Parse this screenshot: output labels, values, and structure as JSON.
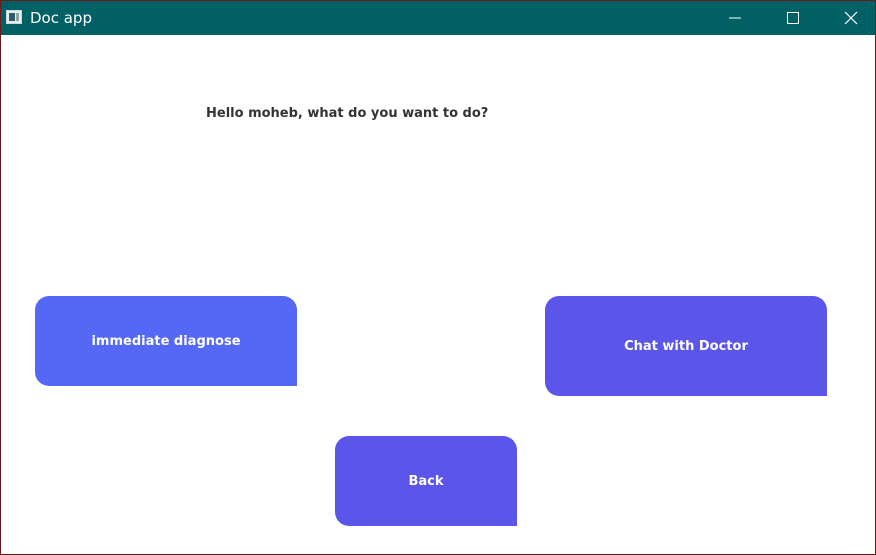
{
  "window": {
    "title": "Doc app",
    "titlebar_color": "#006064",
    "controls": {
      "minimize_icon": "minimize-icon",
      "maximize_icon": "maximize-icon",
      "close_icon": "close-icon"
    }
  },
  "main": {
    "greeting": "Hello moheb, what do you want to do?",
    "buttons": {
      "diagnose_label": "immediate diagnose",
      "chat_label": "Chat with Doctor",
      "back_label": "Back"
    },
    "colors": {
      "diagnose": "#5567f5",
      "chat": "#5b55e9",
      "back": "#5b55e9"
    }
  }
}
